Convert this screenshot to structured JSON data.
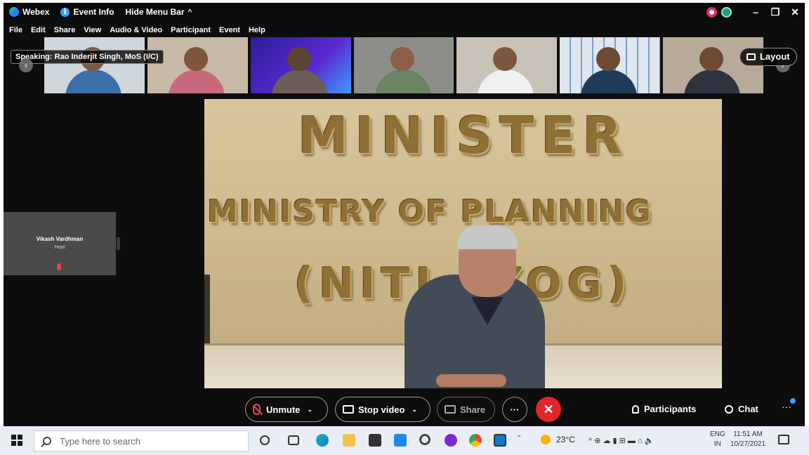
{
  "titlebar": {
    "app_name": "Webex",
    "event_info": "Event Info",
    "hide_menu": "Hide Menu Bar",
    "minimize": "–",
    "restore": "❐",
    "close": "✕"
  },
  "menu": {
    "items": [
      "File",
      "Edit",
      "Share",
      "View",
      "Audio & Video",
      "Participant",
      "Event",
      "Help"
    ]
  },
  "stage": {
    "speaking": "Speaking: Rao Inderjit Singh, MoS (I/C)",
    "layout_label": "Layout",
    "prev_arrow": "‹",
    "next_arrow": "›"
  },
  "host": {
    "name": "Vikash Vardhman",
    "role": "Host"
  },
  "main_video": {
    "sign_line1": "MINISTER",
    "sign_line2": "MINISTRY OF PLANNING",
    "sign_line3": "(NITI AYOG)"
  },
  "controls": {
    "unmute": "Unmute",
    "stop_video": "Stop video",
    "share": "Share",
    "more": "···",
    "end": "✕",
    "participants": "Participants",
    "chat": "Chat",
    "overflow": "···",
    "chevron": "⌄"
  },
  "taskbar": {
    "search_placeholder": "Type here to search",
    "temperature": "23°C",
    "tray_icons": "^  ⊕  ☁  ▮  ⊞  ▬  ⌂  🔈",
    "lang_1": "ENG",
    "lang_2": "IN",
    "time": "11:51 AM",
    "date": "10/27/2021"
  },
  "colors": {
    "end_call": "#e0252b",
    "accent_blue": "#3aa0ff",
    "muted_red": "#e5484d"
  }
}
